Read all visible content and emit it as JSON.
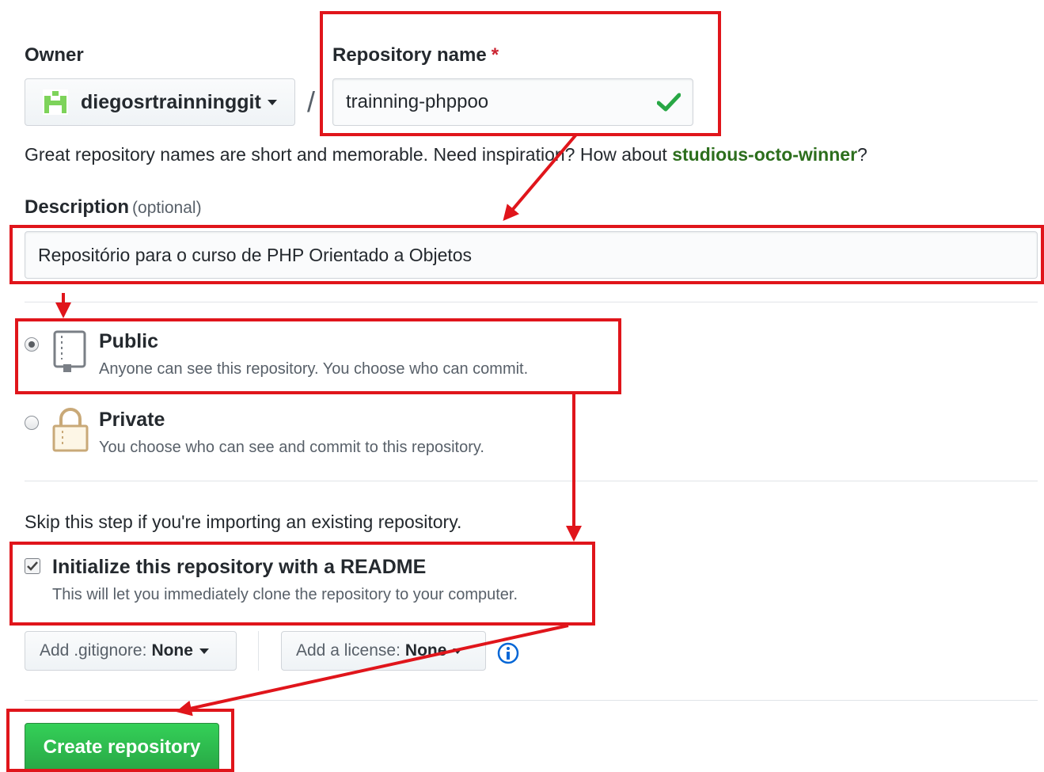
{
  "owner": {
    "label": "Owner",
    "name": "diegosrtrainninggit"
  },
  "separator": "/",
  "repository": {
    "label": "Repository name",
    "required_mark": "*",
    "value": "trainning-phppoo"
  },
  "hint": {
    "prefix": "Great repository names are short and memorable. Need inspiration? How about ",
    "suggestion": "studious-octo-winner",
    "suffix": "?"
  },
  "description": {
    "label": "Description",
    "optional": "(optional)",
    "value": "Repositório para o curso de PHP Orientado a Objetos"
  },
  "visibility": {
    "public": {
      "title": "Public",
      "desc": "Anyone can see this repository. You choose who can commit.",
      "selected": true
    },
    "private": {
      "title": "Private",
      "desc": "You choose who can see and commit to this repository.",
      "selected": false
    }
  },
  "skip_note": "Skip this step if you're importing an existing repository.",
  "readme": {
    "title": "Initialize this repository with a README",
    "desc": "This will let you immediately clone the repository to your computer.",
    "checked": true
  },
  "gitignore": {
    "prefix": "Add .gitignore:",
    "value": "None"
  },
  "license": {
    "prefix": "Add a license:",
    "value": "None"
  },
  "create_button": "Create repository",
  "colors": {
    "annotation": "#e0151b",
    "primary": "#28a745",
    "suggestion": "#2c6e1c"
  }
}
